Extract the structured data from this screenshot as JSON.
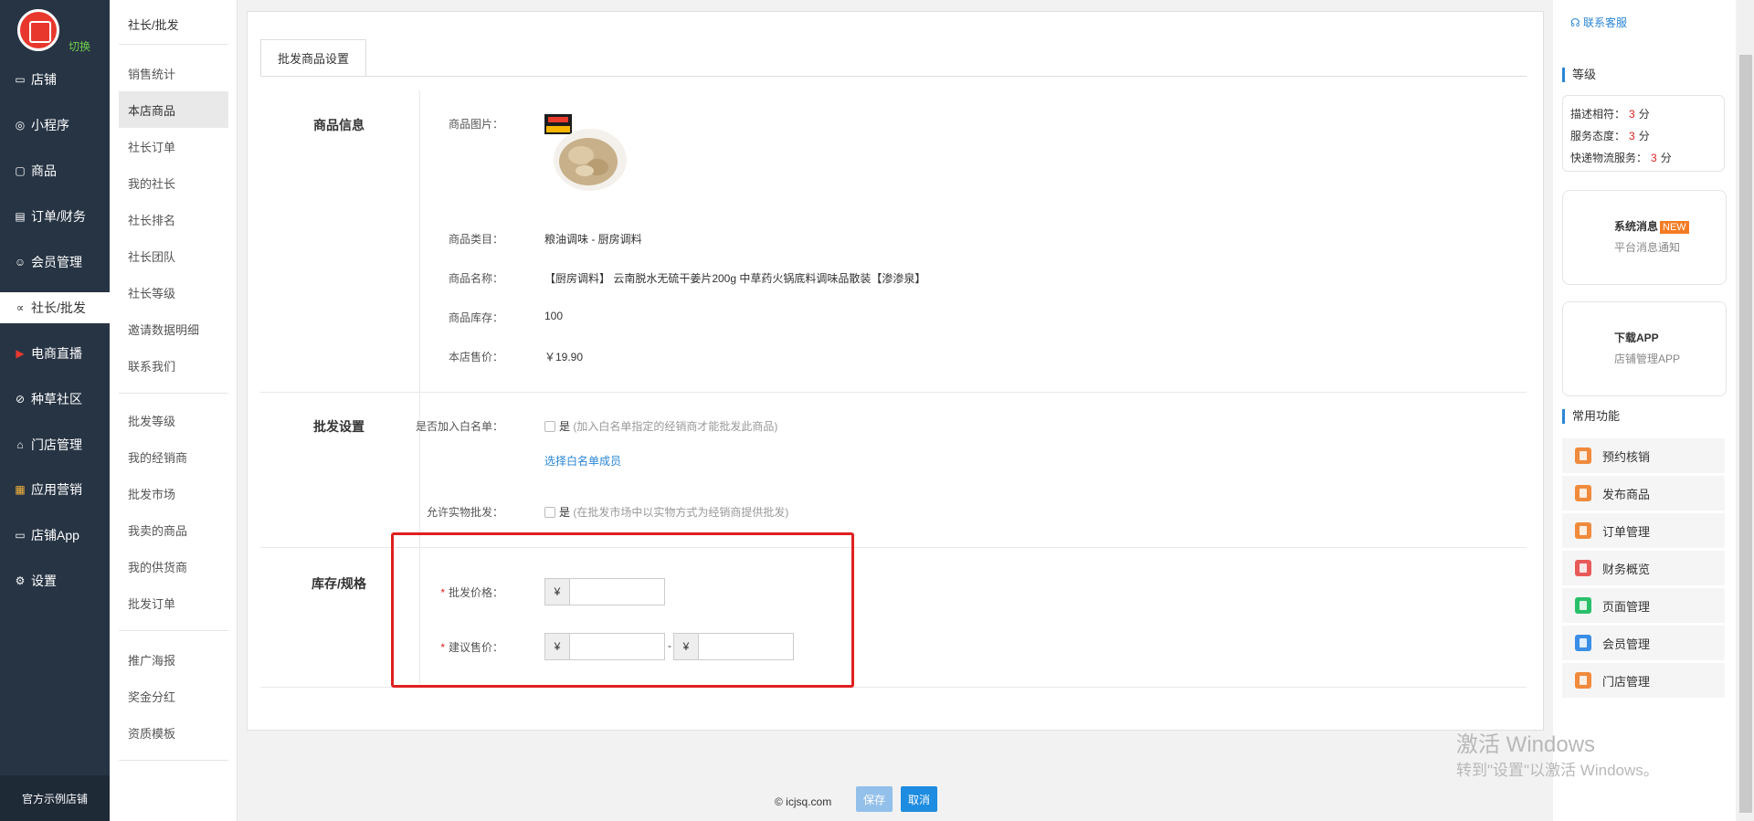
{
  "sidebar": {
    "switch_label": "切换",
    "items": [
      {
        "label": "店铺",
        "icon": "store-icon"
      },
      {
        "label": "小程序",
        "icon": "compass-icon"
      },
      {
        "label": "商品",
        "icon": "bag-icon"
      },
      {
        "label": "订单/财务",
        "icon": "clipboard-icon"
      },
      {
        "label": "会员管理",
        "icon": "user-icon"
      },
      {
        "label": "社长/批发",
        "icon": "share-icon"
      },
      {
        "label": "电商直播",
        "icon": "live-icon"
      },
      {
        "label": "种草社区",
        "icon": "leaf-icon"
      },
      {
        "label": "门店管理",
        "icon": "house-icon"
      },
      {
        "label": "应用营销",
        "icon": "apps-icon"
      },
      {
        "label": "店铺App",
        "icon": "app-icon"
      },
      {
        "label": "设置",
        "icon": "gear-icon"
      }
    ],
    "active_index": 5,
    "footer": "官方示例店铺"
  },
  "subnav": {
    "title": "社长/批发",
    "group1": [
      "销售统计",
      "本店商品",
      "社长订单",
      "我的社长",
      "社长排名",
      "社长团队",
      "社长等级",
      "邀请数据明细",
      "联系我们"
    ],
    "group2": [
      "批发等级",
      "我的经销商",
      "批发市场",
      "我卖的商品",
      "我的供货商",
      "批发订单"
    ],
    "group3": [
      "推广海报",
      "奖金分红",
      "资质模板"
    ],
    "active": "本店商品"
  },
  "main": {
    "tab": "批发商品设置",
    "product_section": "商品信息",
    "product": {
      "image_label": "商品图片：",
      "category_label": "商品类目：",
      "category_value": "粮油调味 - 厨房调料",
      "name_label": "商品名称：",
      "name_value": "【厨房调料】 云南脱水无硫干姜片200g 中草药火锅底料调味品散装【渗渗泉】",
      "stock_label": "商品库存：",
      "stock_value": "100",
      "price_label": "本店售价：",
      "price_value": "￥19.90"
    },
    "wholesale_section": "批发设置",
    "wholesale": {
      "whitelist_label": "是否加入白名单：",
      "whitelist_option": "是",
      "whitelist_desc": "(加入白名单指定的经销商才能批发此商品)",
      "whitelist_link": "选择白名单成员",
      "physical_label": "允许实物批发：",
      "physical_option": "是",
      "physical_desc": "(在批发市场中以实物方式为经销商提供批发)"
    },
    "stock_section": "库存/规格",
    "pricing": {
      "wholesale_price_label": "批发价格：",
      "suggest_price_label": "建议售价：",
      "currency": "¥",
      "separator": "-"
    }
  },
  "footer": {
    "copyright": "© icjsq.com",
    "save": "保存",
    "cancel": "取消"
  },
  "rightbar": {
    "service": "联系客服",
    "level_title": "等级",
    "ratings": [
      {
        "label": "描述相符：",
        "value": "3",
        "unit": "分"
      },
      {
        "label": "服务态度：",
        "value": "3",
        "unit": "分"
      },
      {
        "label": "快递物流服务：",
        "value": "3",
        "unit": "分"
      }
    ],
    "system_msg_title": "系统消息",
    "system_msg_badge": "NEW",
    "system_msg_sub": "平台消息通知",
    "download_title": "下载APP",
    "download_sub": "店铺管理APP",
    "common_title": "常用功能",
    "functions": [
      {
        "label": "预约核销",
        "color": "#f08a3c"
      },
      {
        "label": "发布商品",
        "color": "#f08a3c"
      },
      {
        "label": "订单管理",
        "color": "#f08a3c"
      },
      {
        "label": "财务概览",
        "color": "#e85a5a"
      },
      {
        "label": "页面管理",
        "color": "#2bbf6a"
      },
      {
        "label": "会员管理",
        "color": "#3a8ee6"
      },
      {
        "label": "门店管理",
        "color": "#f08a3c"
      }
    ]
  },
  "watermark": {
    "line1": "激活 Windows",
    "line2": "转到\"设置\"以激活 Windows。"
  }
}
